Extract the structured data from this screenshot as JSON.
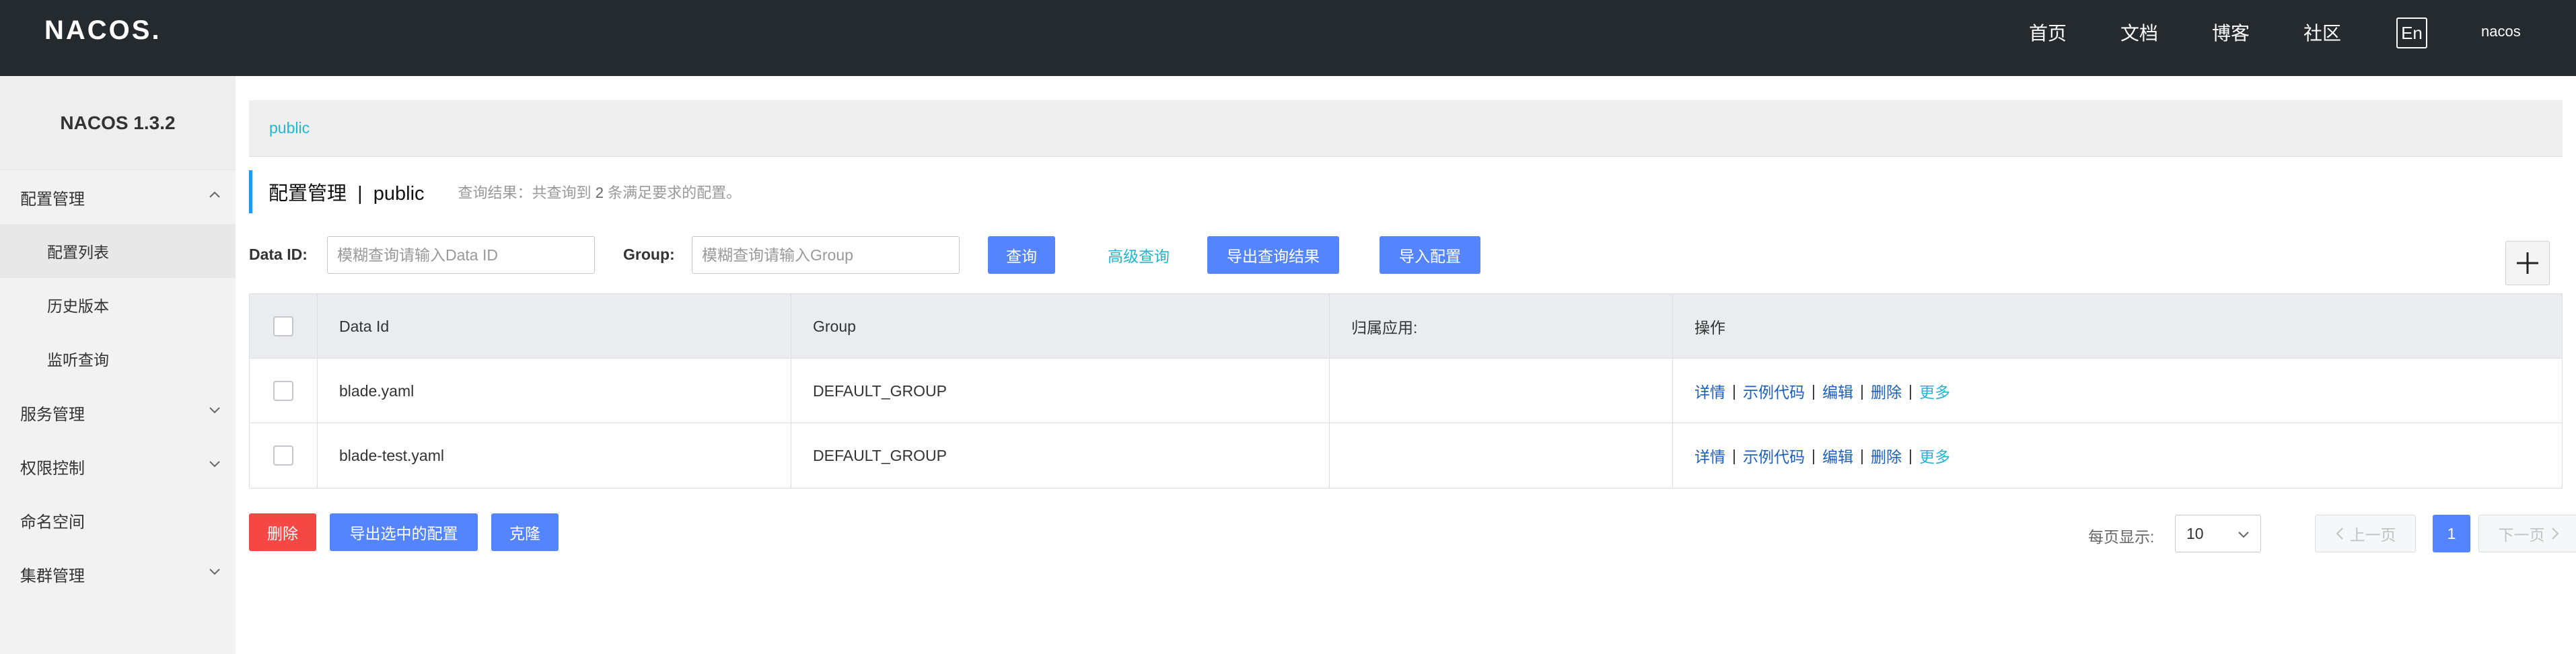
{
  "header": {
    "logo_text": "NACOS.",
    "nav": [
      "首页",
      "文档",
      "博客",
      "社区"
    ],
    "lang_button": "En",
    "username": "nacos"
  },
  "sidebar": {
    "title": "NACOS 1.3.2",
    "groups": [
      {
        "label": "配置管理",
        "expanded": true,
        "items": [
          "配置列表",
          "历史版本",
          "监听查询"
        ]
      },
      {
        "label": "服务管理",
        "expanded": false
      },
      {
        "label": "权限控制",
        "expanded": false
      },
      {
        "label": "命名空间"
      },
      {
        "label": "集群管理",
        "expanded": false
      }
    ]
  },
  "main": {
    "namespace_tab": "public",
    "page_title": "配置管理  |  public",
    "query_result_prefix": "查询结果：共查询到",
    "query_result_count": "2",
    "query_result_suffix": "条满足要求的配置。",
    "filters": {
      "dataid_label": "Data ID:",
      "dataid_placeholder": "模糊查询请输入Data ID",
      "group_label": "Group:",
      "group_placeholder": "模糊查询请输入Group",
      "query_button": "查询",
      "advanced_query": "高级查询",
      "export_results": "导出查询结果",
      "import_config": "导入配置"
    },
    "table": {
      "headers": [
        "Data Id",
        "Group",
        "归属应用:",
        "操作"
      ],
      "rows": [
        {
          "data_id": "blade.yaml",
          "group": "DEFAULT_GROUP",
          "app": ""
        },
        {
          "data_id": "blade-test.yaml",
          "group": "DEFAULT_GROUP",
          "app": ""
        }
      ],
      "ops": {
        "detail": "详情",
        "sample_code": "示例代码",
        "edit": "编辑",
        "delete": "删除",
        "more": "更多",
        "sep": "|"
      }
    },
    "bottom": {
      "delete": "删除",
      "export_selected": "导出选中的配置",
      "clone": "克隆",
      "page_size_label": "每页显示:",
      "page_size": "10",
      "prev": "上一页",
      "current_page": "1",
      "next": "下一页"
    }
  },
  "colors": {
    "topbar": "#252a2f",
    "primary": "#5584ff",
    "danger": "#f54743",
    "link": "#1fb8d3"
  }
}
